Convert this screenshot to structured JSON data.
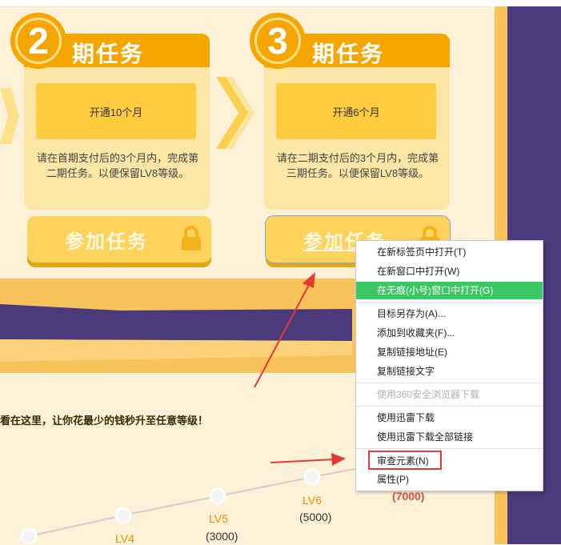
{
  "tasks": [
    {
      "number": "2",
      "title": "期任务",
      "duration": "开通10个月",
      "description": "请在首期支付后的3个月内，完成第二期任务。以便保留LV8等级。",
      "button": "参加任务"
    },
    {
      "number": "3",
      "title": "期任务",
      "duration": "开通6个月",
      "description": "请在二期支付后的3个月内，完成第三期任务。以便保留LV8等级。",
      "button": "参加任务"
    }
  ],
  "promo_text": "看在这里，让你花最少的钱秒升至任意等级！",
  "levels": [
    {
      "label": "LV4",
      "price": ""
    },
    {
      "label": "LV5",
      "price": "(3000)"
    },
    {
      "label": "LV6",
      "price": "(5000)"
    },
    {
      "label": "",
      "price": "(7000)"
    }
  ],
  "context_menu": {
    "items": [
      {
        "label": "在新标签页中打开(T)",
        "state": "normal"
      },
      {
        "label": "在新窗口中打开(W)",
        "state": "normal"
      },
      {
        "label": "在无痕(小号)窗口中打开(G)",
        "state": "highlighted"
      },
      {
        "label": "目标另存为(A)...",
        "state": "normal"
      },
      {
        "label": "添加到收藏夹(F)...",
        "state": "normal"
      },
      {
        "label": "复制链接地址(E)",
        "state": "normal"
      },
      {
        "label": "复制链接文字",
        "state": "normal"
      },
      {
        "label": "使用360安全浏览器下载",
        "state": "disabled"
      },
      {
        "label": "使用迅雷下载",
        "state": "normal"
      },
      {
        "label": "使用迅雷下载全部链接",
        "state": "normal"
      },
      {
        "label": "审查元素(N)",
        "state": "boxed"
      },
      {
        "label": "属性(P)",
        "state": "normal"
      }
    ]
  },
  "colors": {
    "accent_orange": "#f6a600",
    "card_bg": "#fde6a6",
    "button_yellow": "#fdd35c",
    "purple": "#4a3a7c",
    "highlight_green": "#3cc766",
    "annotation_red": "#e53935"
  }
}
